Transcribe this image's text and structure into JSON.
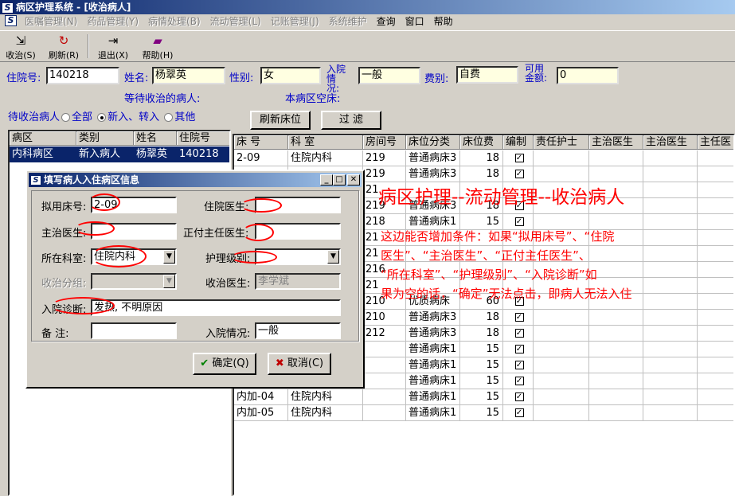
{
  "window": {
    "title": "病区护理系统 - [收治病人]",
    "logo": "S"
  },
  "menu": [
    "医嘱管理(N)",
    "药品管理(Y)",
    "病情处理(B)",
    "流动管理(L)",
    "记账管理(J)",
    "系统维护",
    "查询",
    "窗口",
    "帮助"
  ],
  "toolbar": {
    "admit": {
      "label": "收治(S)",
      "icon": "admit-icon"
    },
    "refresh": {
      "label": "刷新(R)",
      "icon": "refresh-icon"
    },
    "exit": {
      "label": "退出(X)",
      "icon": "exit-icon"
    },
    "help": {
      "label": "帮助(H)",
      "icon": "help-book-icon"
    }
  },
  "patient": {
    "id_label": "住院号:",
    "id_value": "140218",
    "name_label": "姓名:",
    "name_value": "杨翠英",
    "sex_label": "性别:",
    "sex_value": "女",
    "admit_status_label": "入院情况:",
    "admit_status_value": "一般",
    "fee_label": "费别:",
    "fee_value": "自费",
    "amount_label": "可用金额:",
    "amount_value": "0"
  },
  "section": {
    "waiting_label": "等待收治的病人:",
    "empty_beds_label": "本病区空床:"
  },
  "left": {
    "filter_label": "待收治病人",
    "radio_all": "全部",
    "radio_new": "新入、转入",
    "radio_other": "其他",
    "columns": [
      "病区",
      "类别",
      "姓名",
      "住院号"
    ],
    "rows": [
      [
        "内科病区",
        "新入病人",
        "杨翠英",
        "140218"
      ]
    ]
  },
  "beds": {
    "refresh_label": "刷新床位",
    "filter_label": "过 滤",
    "columns": [
      "床 号",
      "科 室",
      "房间号",
      "床位分类",
      "床位费",
      "编制",
      "责任护士",
      "主治医生",
      "主治医生",
      "主任医"
    ],
    "rows": [
      [
        "2-09",
        "住院内科",
        "219",
        "普通病床3",
        "18",
        "☑"
      ],
      [
        "",
        "",
        "219",
        "普通病床3",
        "18",
        "☑"
      ],
      [
        "",
        "",
        "21",
        "",
        "",
        ""
      ],
      [
        "",
        "",
        "219",
        "普通病床3",
        "18",
        "☑"
      ],
      [
        "",
        "",
        "218",
        "普通病床1",
        "15",
        "☑"
      ],
      [
        "",
        "",
        "21",
        "",
        "",
        ""
      ],
      [
        "",
        "",
        "21",
        "",
        "",
        ""
      ],
      [
        "",
        "",
        "216",
        "",
        "",
        ""
      ],
      [
        "",
        "",
        "21",
        "",
        "",
        ""
      ],
      [
        "",
        "",
        "210",
        "优质病床",
        "60",
        "☑"
      ],
      [
        "",
        "",
        "210",
        "普通病床3",
        "18",
        "☑"
      ],
      [
        "",
        "",
        "212",
        "普通病床3",
        "18",
        "☑"
      ],
      [
        "",
        "",
        "",
        "普通病床1",
        "15",
        "☑"
      ],
      [
        "",
        "",
        "",
        "普通病床1",
        "15",
        "☑"
      ],
      [
        "",
        "",
        "",
        "普通病床1",
        "15",
        "☑"
      ],
      [
        "内加-04",
        "住院内科",
        "",
        "普通病床1",
        "15",
        "☑"
      ],
      [
        "内加-05",
        "住院内科",
        "",
        "普通病床1",
        "15",
        "☑"
      ]
    ]
  },
  "dialog": {
    "title": "填写病人入住病区信息",
    "bed_label": "拟用床号:",
    "bed_value": "2-09",
    "res_doctor_label": "住院医生:",
    "res_doctor_value": "",
    "att_doctor_label": "主治医生:",
    "att_doctor_value": "",
    "chief_label": "正付主任医生:",
    "chief_value": "",
    "dept_label": "所在科室:",
    "dept_value": "住院内科",
    "nurse_level_label": "护理级别:",
    "nurse_level_value": "",
    "group_label": "收治分组:",
    "group_value": "",
    "admit_doctor_label": "收治医生:",
    "admit_doctor_value": "李学斌",
    "diagnosis_label": "入院诊断:",
    "diagnosis_value": "发热, 不明原因",
    "note_label": "备 注:",
    "note_value": "",
    "admit_status_label": "入院情况:",
    "admit_status_value": "一般",
    "ok_label": "确定(Q)",
    "cancel_label": "取消(C)"
  },
  "annotation": {
    "heading": "病区护理--流动管理--收治病人",
    "lines": [
      "这边能否增加条件：如果“拟用床号”、“住院",
      "医生”、“主治医生”、“正付主任医生”、",
      "“所在科室”、“护理级别”、“入院诊断”如",
      "果为空的话，“确定”无法点击，即病人无法入住"
    ],
    "color": "#ff0000"
  }
}
